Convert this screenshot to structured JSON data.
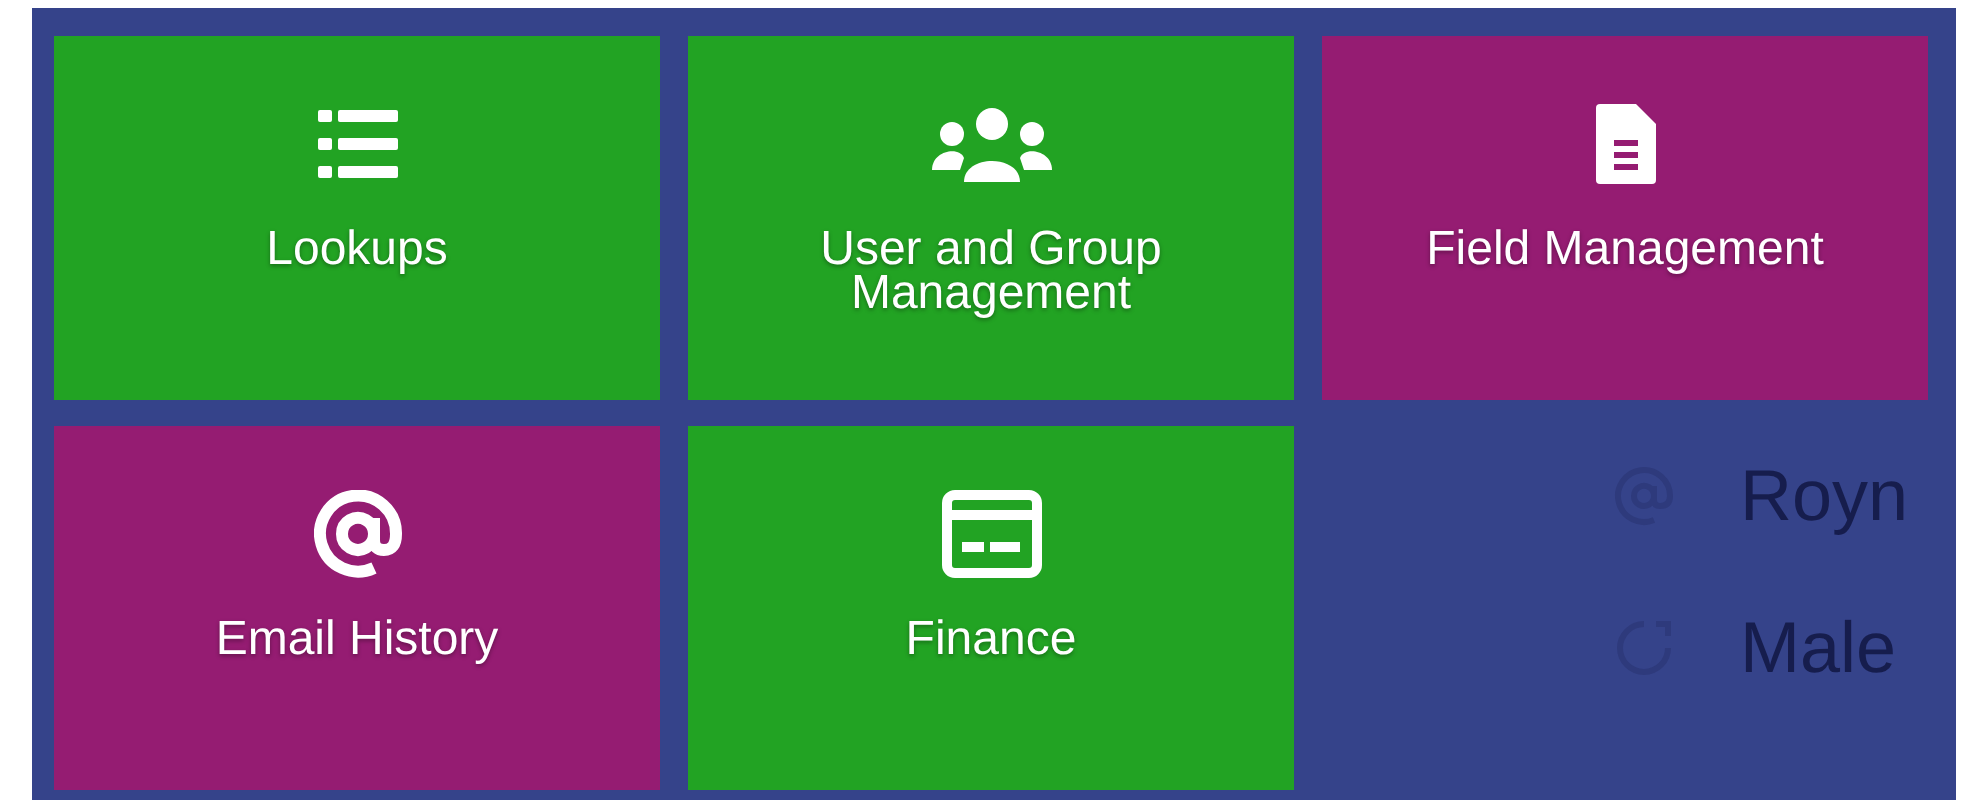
{
  "tiles": [
    {
      "label": "Lookups",
      "color": "#22a323"
    },
    {
      "label": "User and Group Management",
      "color": "#22a323"
    },
    {
      "label": "Field Management",
      "color": "#951c72"
    },
    {
      "label": "Email History",
      "color": "#951c72"
    },
    {
      "label": "Finance",
      "color": "#22a323"
    }
  ],
  "background_list": [
    {
      "label": "Royn"
    },
    {
      "label": "Male"
    }
  ]
}
